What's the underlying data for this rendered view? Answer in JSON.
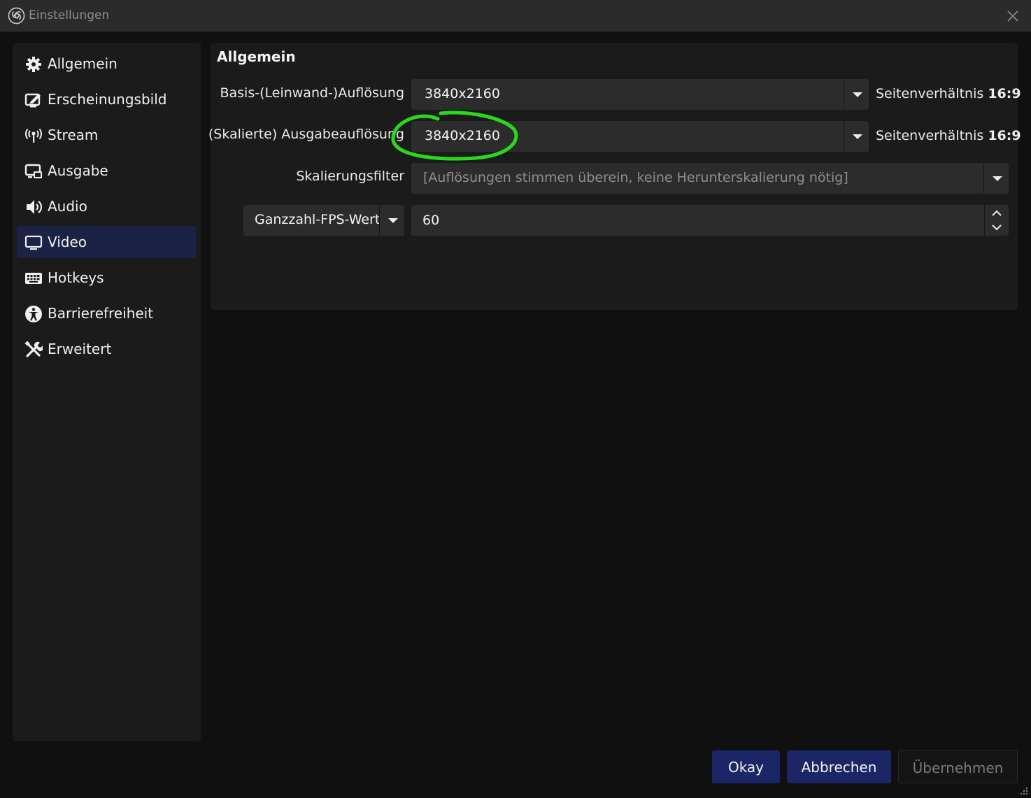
{
  "window": {
    "title": "Einstellungen",
    "app_icon": "obs-logo-icon",
    "close_icon": "close-icon"
  },
  "sidebar": {
    "items": [
      {
        "label": "Allgemein",
        "icon": "gear-icon",
        "active": false
      },
      {
        "label": "Erscheinungsbild",
        "icon": "appearance-icon",
        "active": false
      },
      {
        "label": "Stream",
        "icon": "antenna-icon",
        "active": false
      },
      {
        "label": "Ausgabe",
        "icon": "output-icon",
        "active": false
      },
      {
        "label": "Audio",
        "icon": "speaker-icon",
        "active": false
      },
      {
        "label": "Video",
        "icon": "monitor-icon",
        "active": true
      },
      {
        "label": "Hotkeys",
        "icon": "keyboard-icon",
        "active": false
      },
      {
        "label": "Barrierefreiheit",
        "icon": "accessibility-icon",
        "active": false
      },
      {
        "label": "Erweitert",
        "icon": "tools-icon",
        "active": false
      }
    ]
  },
  "main": {
    "section_title": "Allgemein",
    "base_resolution": {
      "label": "Basis-(Leinwand-)Auflösung",
      "value": "3840x2160",
      "ratio_prefix": "Seitenverhältnis",
      "ratio_value": "16:9"
    },
    "output_resolution": {
      "label": "(Skalierte) Ausgabeauflösung",
      "value": "3840x2160",
      "ratio_prefix": "Seitenverhältnis",
      "ratio_value": "16:9"
    },
    "scale_filter": {
      "label": "Skalierungsfilter",
      "value": "[Auflösungen stimmen überein, keine Herunterskalierung nötig]"
    },
    "fps": {
      "type_value": "Ganzzahl-FPS-Wert",
      "value": "60"
    }
  },
  "buttons": {
    "ok": "Okay",
    "cancel": "Abbrechen",
    "apply": "Übernehmen"
  },
  "colors": {
    "accent": "#1c2667",
    "active_nav": "#1c2245",
    "annotation": "#2ad91c"
  }
}
